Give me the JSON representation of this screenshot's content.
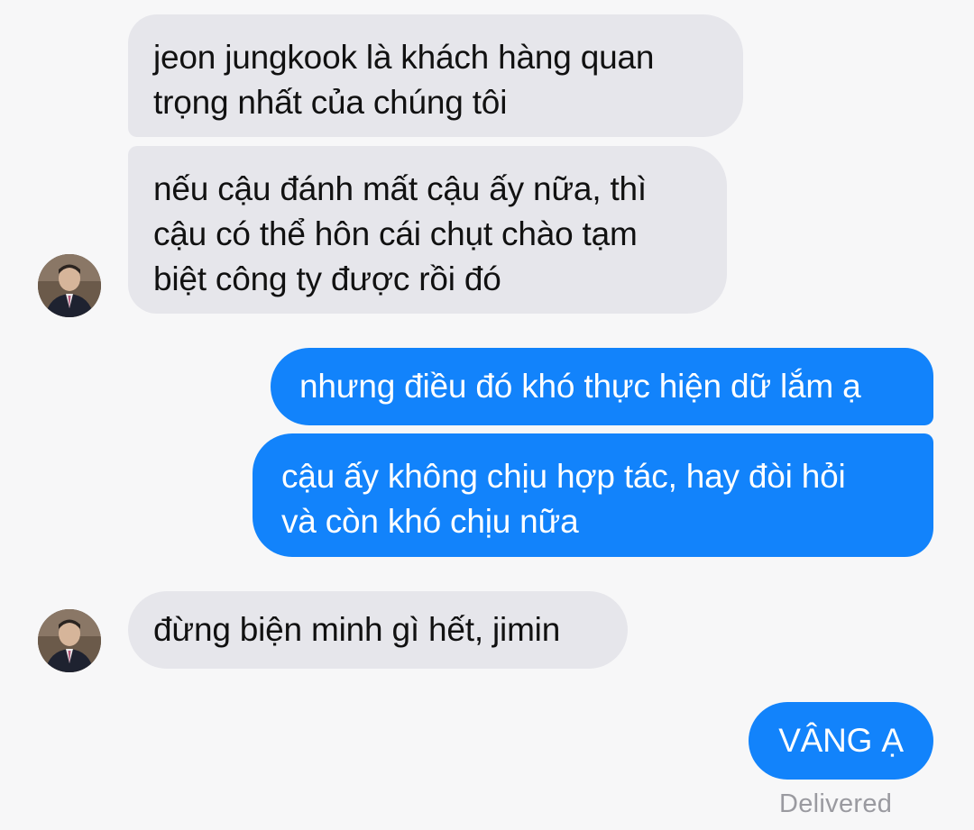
{
  "messages": [
    {
      "sender": "them",
      "text_lines": [
        "jeon jungkook là khách hàng quan",
        "trọng nhất của chúng tôi"
      ]
    },
    {
      "sender": "them",
      "text_lines": [
        "nếu cậu đánh mất cậu ấy nữa, thì",
        "cậu có thể hôn cái chụt chào tạm",
        "biệt công ty được rồi đó"
      ]
    },
    {
      "sender": "me",
      "text_lines": [
        "nhưng điều đó khó thực hiện dữ lắm ạ"
      ]
    },
    {
      "sender": "me",
      "text_lines": [
        "cậu ấy không chịu hợp tác, hay đòi hỏi",
        "và còn khó chịu nữa"
      ]
    },
    {
      "sender": "them",
      "text_lines": [
        "đừng biện minh gì hết, jimin"
      ]
    },
    {
      "sender": "me",
      "text_lines": [
        "VÂNG Ạ"
      ]
    }
  ],
  "status": "Delivered",
  "colors": {
    "incoming_bubble": "#e6e6eb",
    "outgoing_bubble": "#1283fb",
    "background": "#f7f7f8"
  },
  "avatar_icon": "person-avatar"
}
